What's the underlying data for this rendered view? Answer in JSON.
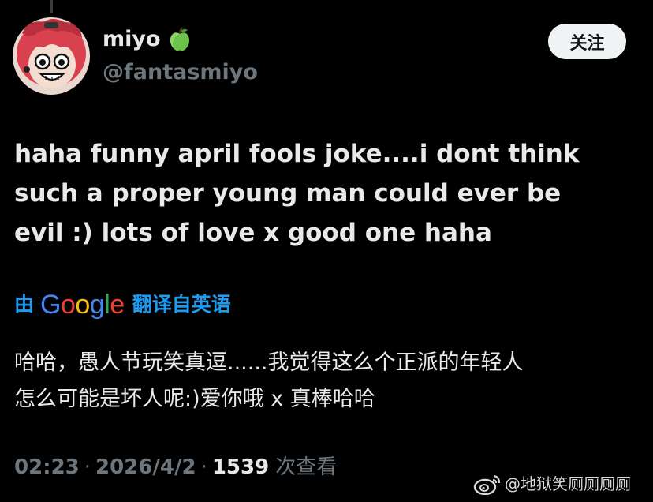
{
  "user": {
    "name": "miyo",
    "badge_icon": "green-apple-icon",
    "handle": "@fantasmiyo",
    "avatar": "cartoon-girl-avatar"
  },
  "follow_button": {
    "label": "关注"
  },
  "tweet": {
    "lines": [
      "haha funny april fools joke....i dont think",
      "such a proper young man could ever be",
      "evil :) lots of love x good one haha"
    ]
  },
  "translation": {
    "prefix": "由",
    "provider": "Google",
    "suffix": "翻译自英语",
    "lines": [
      "哈哈，愚人节玩笑真逗......我觉得这么个正派的年轻人",
      "怎么可能是坏人呢:)爱你哦 x 真棒哈哈"
    ]
  },
  "meta": {
    "time": "02:23",
    "separator": "·",
    "date": "2026/4/2",
    "views_count": "1539",
    "views_label": "次查看"
  },
  "watermark": {
    "text": "@地狱笑厕厕厕厕",
    "icon": "weibo-logo-icon"
  },
  "colors": {
    "background": "#000000",
    "text": "#e7e9ea",
    "secondary": "#6e767d",
    "link": "#1d9bf0",
    "button_bg": "#eff3f4"
  }
}
